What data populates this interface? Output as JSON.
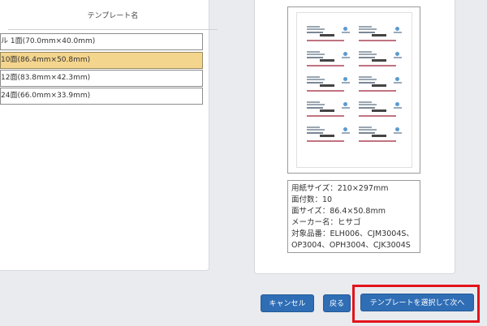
{
  "template_list": {
    "header": "テンプレート名",
    "items": [
      {
        "label": "ル 1面(70.0mm×40.0mm)",
        "selected": false
      },
      {
        "label": "10面(86.4mm×50.8mm)",
        "selected": true
      },
      {
        "label": "12面(83.8mm×42.3mm)",
        "selected": false
      },
      {
        "label": "24面(66.0mm×33.9mm)",
        "selected": false
      }
    ]
  },
  "info": {
    "paper_size": "用紙サイズ：210×297mm",
    "count": "面付数：10",
    "face_size": "面サイズ：86.4×50.8mm",
    "maker": "メーカー名：ヒサゴ",
    "products_1": "対象品番：ELH006、CJM3004S、",
    "products_2": "OP3004、OPH3004、CJK3004S"
  },
  "buttons": {
    "cancel": "キャンセル",
    "back": "戻る",
    "next": "テンプレートを選択して次へ"
  },
  "colors": {
    "selected_bg": "#f4d58d",
    "button_bg": "#2f6eb5",
    "highlight": "#e3131b"
  }
}
